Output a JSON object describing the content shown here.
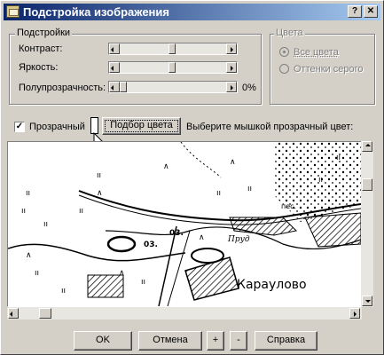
{
  "window": {
    "title": "Подстройка изображения"
  },
  "adjust": {
    "legend": "Подстройки",
    "contrast_label": "Контраст:",
    "brightness_label": "Яркость:",
    "transparency_label": "Полупрозрачность:",
    "transparency_value": "0%",
    "contrast_level": 0.5,
    "brightness_level": 0.5,
    "transparency_level": 0.0
  },
  "colors": {
    "legend": "Цвета",
    "all_colors": "Все цвета",
    "grayscale": "Оттенки серого",
    "selected": "all_colors"
  },
  "transparent": {
    "label": "Прозрачный",
    "checked": true,
    "pick_button": "Подбор цвета",
    "hint": "Выберите мышкой прозрачный цвет:"
  },
  "map": {
    "place_label": "Караулово",
    "label_03a": "03.",
    "label_03b": "03.",
    "label_pes": "пес.",
    "label_prud": "Пруд"
  },
  "buttons": {
    "ok": "OK",
    "cancel": "Отмена",
    "plus": "+",
    "minus": "-",
    "help": "Справка"
  },
  "icons": {
    "title": "image-adjust-icon",
    "help": "help-icon",
    "close": "close-icon"
  }
}
